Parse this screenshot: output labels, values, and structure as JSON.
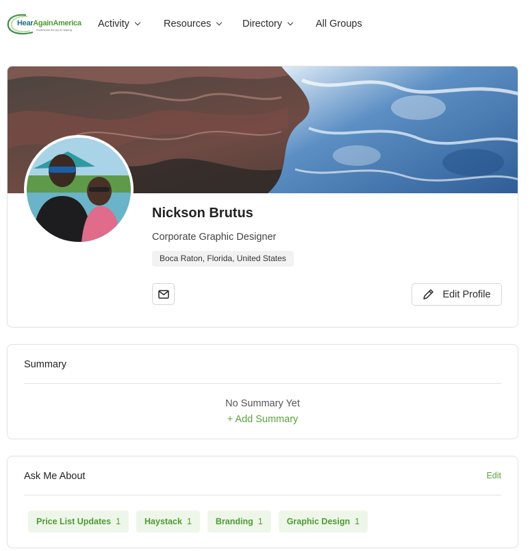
{
  "brand": {
    "logo_word_1": "Hear",
    "logo_word_2": "Again",
    "logo_word_3": "America",
    "tagline": "Experience the joy of hearing",
    "primary_color": "#5aa23d"
  },
  "nav": {
    "items": [
      {
        "label": "Activity",
        "has_dropdown": true
      },
      {
        "label": "Resources",
        "has_dropdown": true
      },
      {
        "label": "Directory",
        "has_dropdown": true
      },
      {
        "label": "All Groups",
        "has_dropdown": false
      }
    ]
  },
  "profile": {
    "name": "Nickson Brutus",
    "title": "Corporate Graphic Designer",
    "location": "Boca Raton, Florida, United States",
    "message_icon": "envelope-icon",
    "edit_label": "Edit Profile",
    "edit_icon": "pencil-icon"
  },
  "summary": {
    "heading": "Summary",
    "empty_text": "No Summary Yet",
    "add_label": "+ Add Summary"
  },
  "ask_me_about": {
    "heading": "Ask Me About",
    "edit_label": "Edit",
    "tags": [
      {
        "label": "Price List Updates",
        "count": "1"
      },
      {
        "label": "Haystack",
        "count": "1"
      },
      {
        "label": "Branding",
        "count": "1"
      },
      {
        "label": "Graphic Design",
        "count": "1"
      }
    ]
  }
}
